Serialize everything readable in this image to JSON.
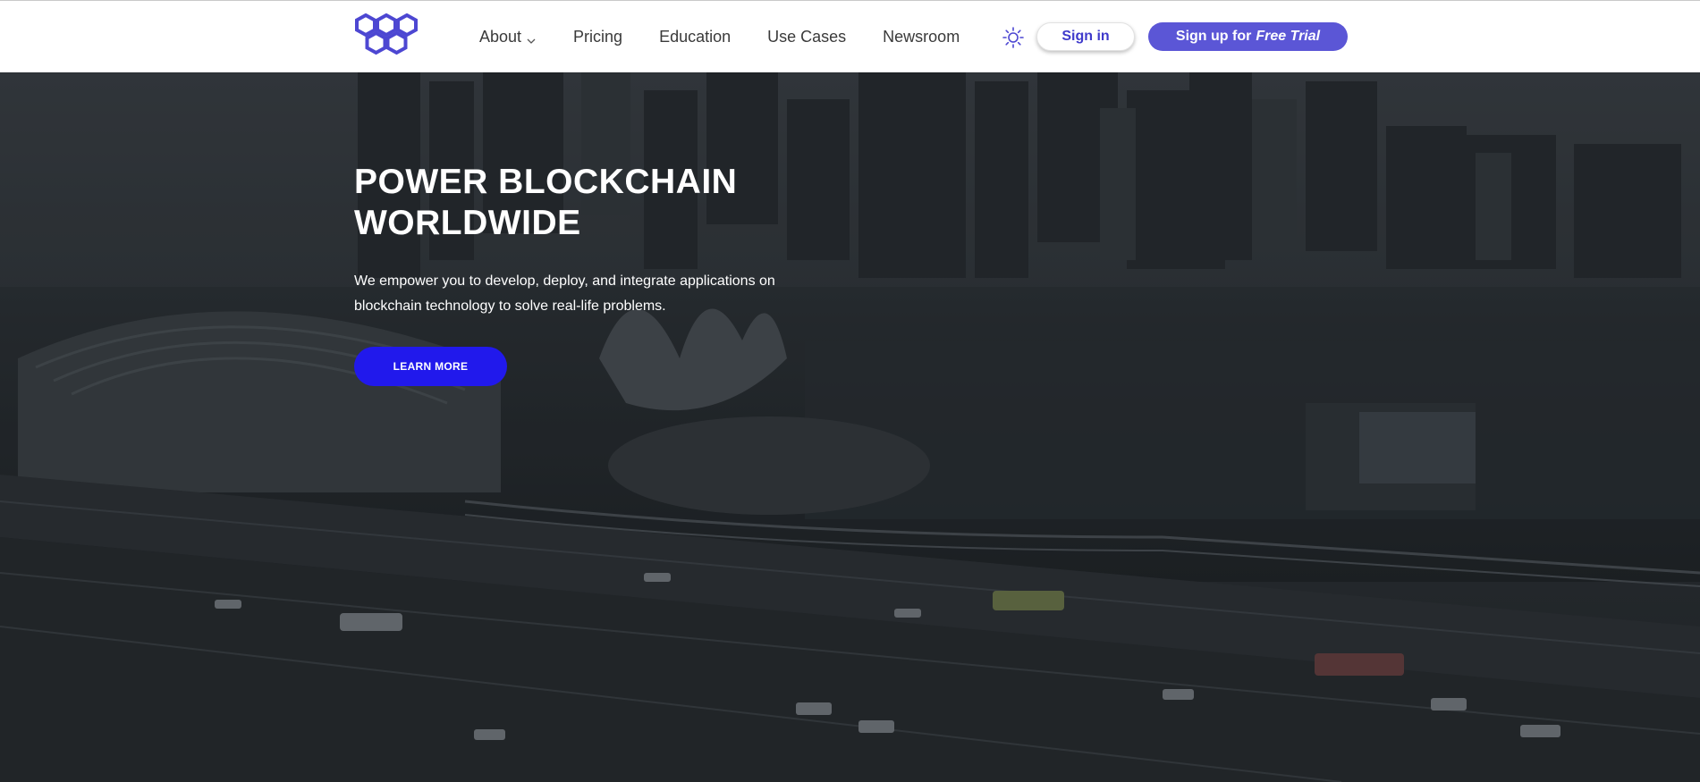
{
  "brand": {
    "logo_icon": "hexagon-cluster-logo",
    "accent_color": "#5b56d6"
  },
  "nav": {
    "items": [
      {
        "label": "About",
        "has_dropdown": true
      },
      {
        "label": "Pricing"
      },
      {
        "label": "Education"
      },
      {
        "label": "Use Cases"
      },
      {
        "label": "Newsroom"
      }
    ],
    "theme_icon": "sun-icon"
  },
  "auth": {
    "signin_label": "Sign in",
    "signup_prefix": "Sign up for",
    "signup_emphasis": "Free Trial"
  },
  "hero": {
    "title_line1": "POWER BLOCKCHAIN",
    "title_line2": "WORLDWIDE",
    "description_line1": "We empower you to develop, deploy, and integrate applications on",
    "description_line2": "blockchain technology to solve real-life problems.",
    "cta_label": "LEARN MORE",
    "cta_color": "#2119ec"
  }
}
